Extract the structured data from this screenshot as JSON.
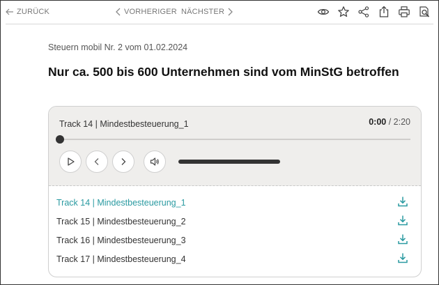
{
  "nav": {
    "back_label": "ZURÜCK",
    "prev_label": "VORHERIGER",
    "next_label": "NÄCHSTER"
  },
  "toolbar": {
    "icons": [
      "eye-icon",
      "star-icon",
      "share-icon",
      "export-icon",
      "print-icon",
      "search-icon"
    ]
  },
  "article": {
    "meta": "Steuern mobil Nr. 2 vom 01.02.2024",
    "title": "Nur ca. 500 bis 600 Unternehmen sind vom MinStG betroffen"
  },
  "player": {
    "current_track": "Track 14 | Mindestbesteuerung_1",
    "time_current": "0:00",
    "time_separator": " / ",
    "time_total": "2:20",
    "progress_fraction": 0.0,
    "volume_fraction": 1.0
  },
  "tracks": [
    {
      "label": "Track 14 | Mindestbesteuerung_1",
      "active": true
    },
    {
      "label": "Track 15 | Mindestbesteuerung_2",
      "active": false
    },
    {
      "label": "Track 16 | Mindestbesteuerung_3",
      "active": false
    },
    {
      "label": "Track 17 | Mindestbesteuerung_4",
      "active": false
    }
  ],
  "colors": {
    "accent": "#2a9aa1",
    "player_bg": "#efeeec",
    "icon": "#444444"
  }
}
